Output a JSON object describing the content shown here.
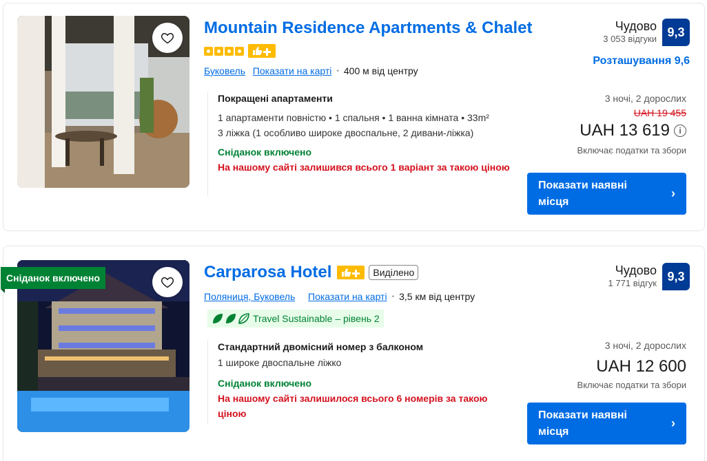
{
  "listings": [
    {
      "name": "Mountain Residence Apartments & Chalet",
      "stars": 4,
      "preferred_plus": true,
      "city": "Буковель",
      "show_on_map": "Показати на карті",
      "distance": "400 м від центру",
      "review_word": "Чудово",
      "review_count": "3 053 відгуки",
      "score": "9,3",
      "location_score": "Розташування 9,6",
      "room_name": "Покращені апартаменти",
      "room_details": "1 апартаменти повністю • 1 спальня • 1 ванна кімната • 33m²",
      "beds": "3 ліжка (1 особливо широке двоспальне, 2 дивани-ліжка)",
      "breakfast": "Сніданок включено",
      "scarcity": "На нашому сайті залишився всього 1 варіант за такою ціною",
      "nights_guests": "3 ночі, 2 дорослих",
      "old_price": "UAH 19 455",
      "price": "UAH 13 619",
      "taxes": "Включає податки та збори",
      "cta": "Показати наявні місця"
    },
    {
      "name": "Carparosa Hotel",
      "ribbon": "Сніданок включено",
      "preferred_plus": true,
      "highlighted": "Виділено",
      "city": "Поляниця, Буковель",
      "show_on_map": "Показати на карті",
      "distance": "3,5 км від центру",
      "sustainable": "Travel Sustainable – рівень 2",
      "review_word": "Чудово",
      "review_count": "1 771 відгук",
      "score": "9,3",
      "room_name": "Стандартний двомісний номер з балконом",
      "beds": "1 широке двоспальне ліжко",
      "breakfast": "Сніданок включено",
      "scarcity": "На нашому сайті залишилося всього 6 номерів за такою ціною",
      "nights_guests": "3 ночі, 2 дорослих",
      "price": "UAH 12 600",
      "taxes": "Включає податки та збори",
      "cta": "Показати наявні місця"
    }
  ],
  "icons": {
    "favorite": "heart-icon",
    "info": "info-icon",
    "chevron": "chevron-right-icon",
    "preferred": "thumbs-up-plus-icon",
    "leaf": "leaf-icon"
  },
  "colors": {
    "link": "#006ce4",
    "score_bg": "#003b95",
    "button": "#006ce4",
    "breakfast_green": "#008234",
    "scarcity_red": "#d4111e",
    "star_yellow": "#febb02"
  }
}
